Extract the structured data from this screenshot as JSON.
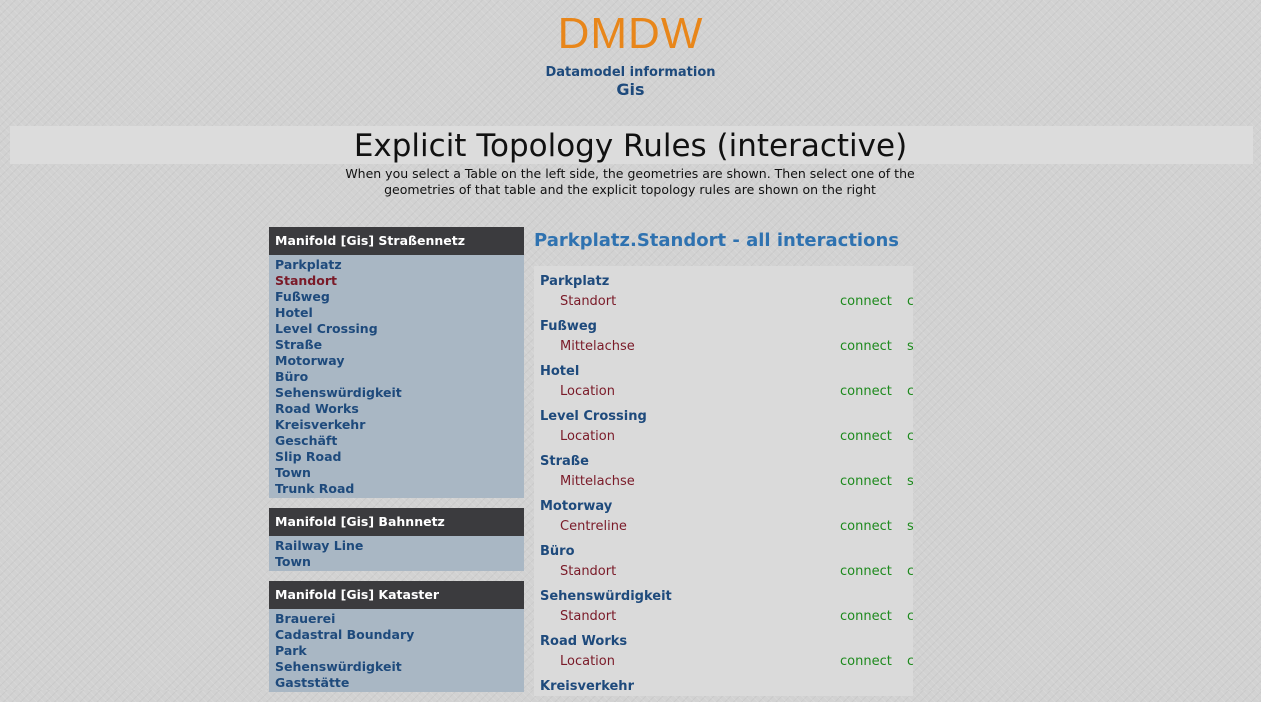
{
  "header": {
    "logo": "DMDW",
    "subtitle": "Datamodel information",
    "database": "Gis"
  },
  "page": {
    "title": "Explicit Topology Rules (interactive)",
    "description": "When you select a Table on the left side, the geometries are shown. Then select one of the geometries of that table and the explicit topology rules are shown on the right"
  },
  "sidebar": {
    "groups": [
      {
        "title": "Manifold [Gis] Straßennetz",
        "items": [
          "Parkplatz",
          "Standort",
          "Fußweg",
          "Hotel",
          "Level Crossing",
          "Straße",
          "Motorway",
          "Büro",
          "Sehenswürdigkeit",
          "Road Works",
          "Kreisverkehr",
          "Geschäft",
          "Slip Road",
          "Town",
          "Trunk Road"
        ],
        "selected": "Standort"
      },
      {
        "title": "Manifold [Gis] Bahnnetz",
        "items": [
          "Railway Line",
          "Town"
        ]
      },
      {
        "title": "Manifold [Gis] Kataster",
        "items": [
          "Brauerei",
          "Cadastral Boundary",
          "Park",
          "Sehenswürdigkeit",
          "Gaststätte"
        ]
      }
    ]
  },
  "main": {
    "title": "Parkplatz.Standort - all interactions",
    "rules": [
      {
        "table": "Parkplatz",
        "geometry": "Standort",
        "rule": "connect",
        "more": "c"
      },
      {
        "table": "Fußweg",
        "geometry": "Mittelachse",
        "rule": "connect",
        "more": "s"
      },
      {
        "table": "Hotel",
        "geometry": "Location",
        "rule": "connect",
        "more": "c"
      },
      {
        "table": "Level Crossing",
        "geometry": "Location",
        "rule": "connect",
        "more": "c"
      },
      {
        "table": "Straße",
        "geometry": "Mittelachse",
        "rule": "connect",
        "more": "s"
      },
      {
        "table": "Motorway",
        "geometry": "Centreline",
        "rule": "connect",
        "more": "s"
      },
      {
        "table": "Büro",
        "geometry": "Standort",
        "rule": "connect",
        "more": "c"
      },
      {
        "table": "Sehenswürdigkeit",
        "geometry": "Standort",
        "rule": "connect",
        "more": "c"
      },
      {
        "table": "Road Works",
        "geometry": "Location",
        "rule": "connect",
        "more": "c"
      },
      {
        "table": "Kreisverkehr",
        "geometry": "",
        "rule": "",
        "more": ""
      }
    ]
  }
}
